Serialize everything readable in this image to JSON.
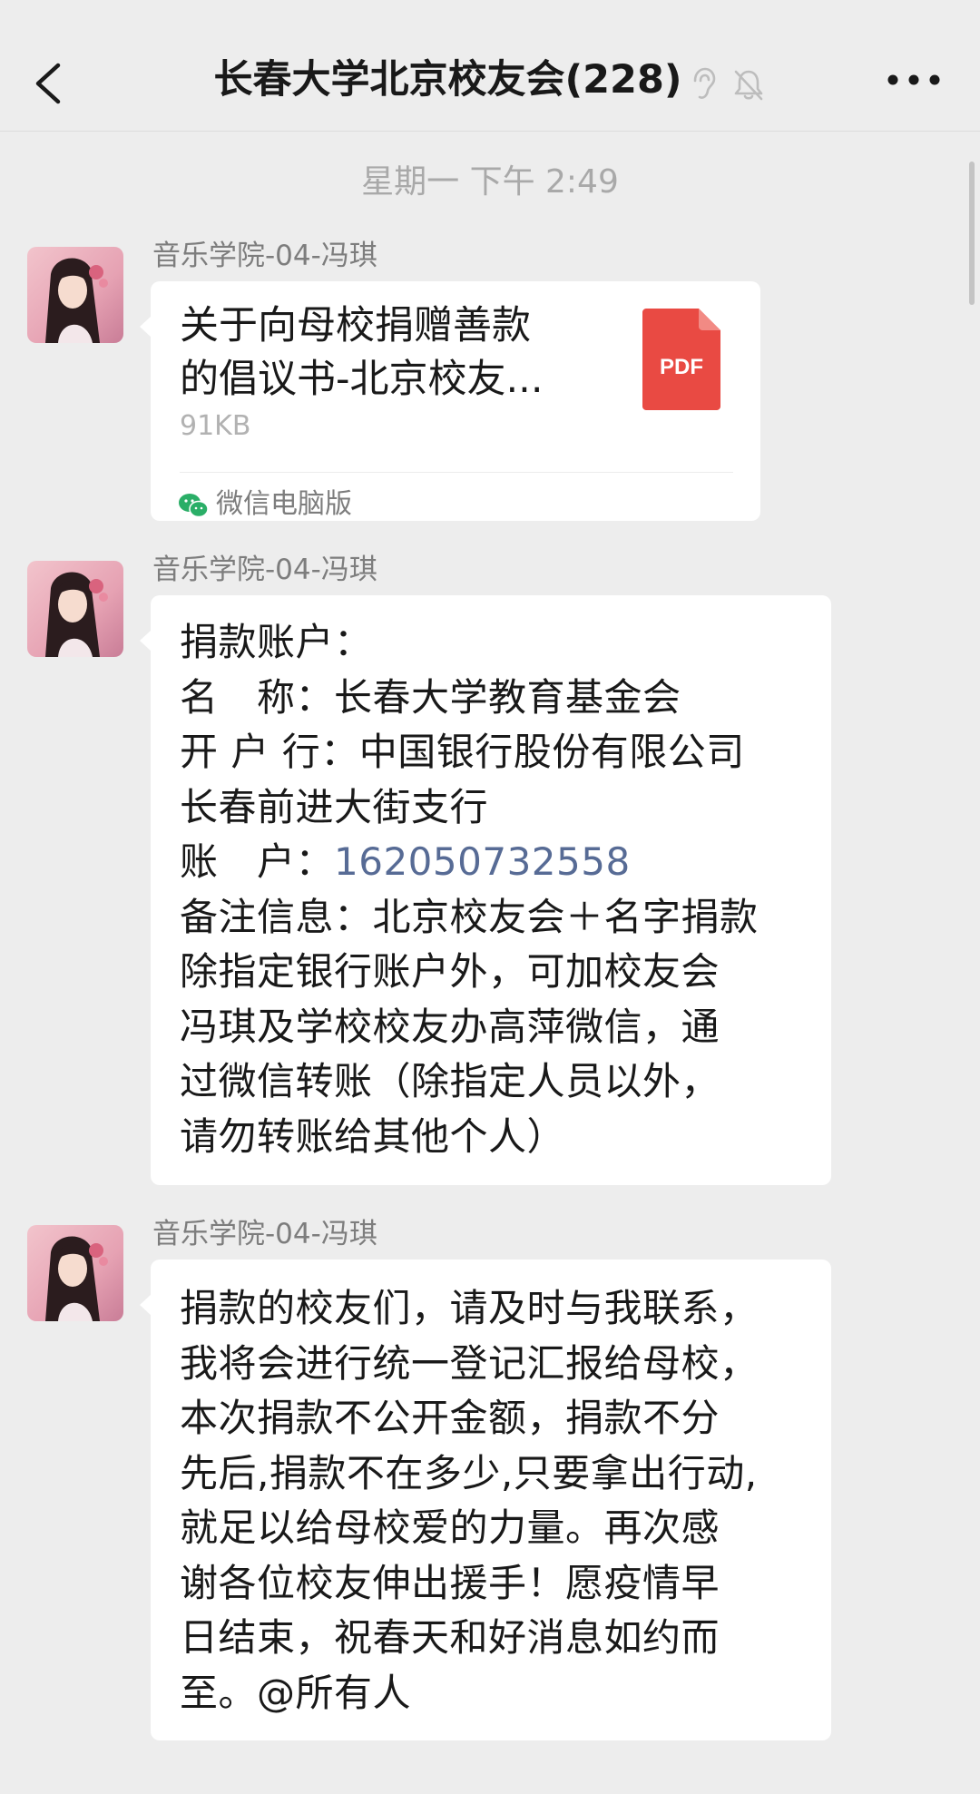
{
  "header": {
    "title": "长春大学北京校友会",
    "member_count": "(228)",
    "icons": [
      "ear-icon",
      "mute-bell-icon"
    ],
    "more_icon": "more-icon",
    "back_icon": "back-chevron-icon"
  },
  "timestamp": "星期一 下午 2:49",
  "messages": [
    {
      "sender": "音乐学院-04-冯琪",
      "type": "file",
      "file_name_lines": [
        "关于向母校捐赠善款",
        "的倡议书-北京校友..."
      ],
      "file_size": "91KB",
      "file_badge": "PDF",
      "source": "微信电脑版"
    },
    {
      "sender": "音乐学院-04-冯琪",
      "type": "text",
      "lines": {
        "l1": "捐款账户：",
        "l2": "名　称：长春大学教育基金会",
        "l3": "开 户 行：中国银行股份有限公司",
        "l4": "长春前进大街支行",
        "l5_label": "账　户：",
        "l5_value": "162050732558",
        "l6": "备注信息：北京校友会＋名字捐款",
        "l7": "除指定银行账户外，可加校友会",
        "l8": "冯琪及学校校友办高萍微信，通",
        "l9": "过微信转账（除指定人员以外，",
        "l10": "请勿转账给其他个人）"
      }
    },
    {
      "sender": "音乐学院-04-冯琪",
      "type": "text",
      "lines": [
        "捐款的校友们，请及时与我联系，",
        "我将会进行统一登记汇报给母校，",
        "本次捐款不公开金额，捐款不分",
        "先后,捐款不在多少,只要拿出行动,",
        "就足以给母校爱的力量。再次感",
        "谢各位校友伸出援手！愿疫情早",
        "日结束，祝春天和好消息如约而",
        "至。@所有人"
      ]
    }
  ],
  "colors": {
    "background": "#ededed",
    "bubble": "#ffffff",
    "link": "#576b95",
    "pdf_red": "#e94a43"
  }
}
